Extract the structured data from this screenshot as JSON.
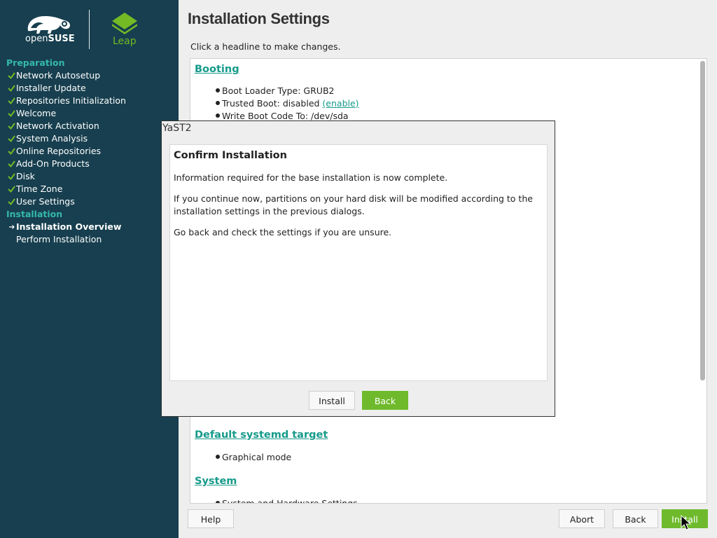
{
  "brand": {
    "suse_word_light": "open",
    "suse_word_bold": "SUSE",
    "leap_word": "Leap",
    "colors": {
      "sidebar": "#173f4f",
      "accent": "#35b9ab",
      "green": "#73ba25",
      "link": "#159a8a"
    }
  },
  "sidebar": {
    "categories": [
      {
        "label": "Preparation",
        "items": [
          {
            "label": "Network Autosetup",
            "state": "done"
          },
          {
            "label": "Installer Update",
            "state": "done"
          },
          {
            "label": "Repositories Initialization",
            "state": "done"
          },
          {
            "label": "Welcome",
            "state": "done"
          },
          {
            "label": "Network Activation",
            "state": "done"
          },
          {
            "label": "System Analysis",
            "state": "done"
          },
          {
            "label": "Online Repositories",
            "state": "done"
          },
          {
            "label": "Add-On Products",
            "state": "done"
          },
          {
            "label": "Disk",
            "state": "done"
          },
          {
            "label": "Time Zone",
            "state": "done"
          },
          {
            "label": "User Settings",
            "state": "done"
          }
        ]
      },
      {
        "label": "Installation",
        "items": [
          {
            "label": "Installation Overview",
            "state": "current"
          },
          {
            "label": "Perform Installation",
            "state": "pending"
          }
        ]
      }
    ]
  },
  "main": {
    "title": "Installation Settings",
    "hint": "Click a headline to make changes.",
    "sections": {
      "booting": {
        "heading": "Booting",
        "bullets": {
          "loader": "Boot Loader Type: GRUB2",
          "trusted_prefix": "Trusted Boot: disabled ",
          "trusted_link": "(enable)",
          "code": "Write Boot Code To: /dev/sda"
        }
      },
      "systemd": {
        "heading": "Default systemd target",
        "bullet": "Graphical mode"
      },
      "system": {
        "heading": "System",
        "bullet_partial": "System and Hardware Settings"
      }
    }
  },
  "buttons": {
    "help": "Help",
    "abort": "Abort",
    "back": "Back",
    "install": "Install"
  },
  "dialog": {
    "window_title": "YaST2",
    "heading": "Confirm Installation",
    "para1": "Information required for the base installation is now complete.",
    "para2": "If you continue now, partitions on your hard disk will be modified according to the installation settings in the previous dialogs.",
    "para3": "Go back and check the settings if you are unsure.",
    "install_label": "Install",
    "back_label": "Back"
  }
}
